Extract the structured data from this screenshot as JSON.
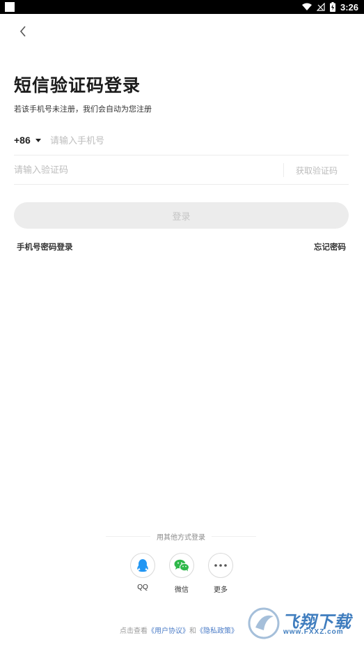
{
  "status_bar": {
    "time": "3:26",
    "icons": [
      "app-notification-icon",
      "wifi-icon",
      "no-signal-icon",
      "battery-charging-icon"
    ]
  },
  "header": {
    "back_icon": "chevron-left-icon",
    "title": "短信验证码登录",
    "subtitle": "若该手机号未注册，我们会自动为您注册"
  },
  "form": {
    "country_code": "+86",
    "phone_placeholder": "请输入手机号",
    "phone_value": "",
    "code_placeholder": "请输入验证码",
    "code_value": "",
    "get_code_label": "获取验证码",
    "login_label": "登录"
  },
  "links": {
    "password_login": "手机号密码登录",
    "forgot_password": "忘记密码"
  },
  "other_login": {
    "title": "用其他方式登录",
    "options": [
      {
        "label": "QQ",
        "icon": "qq-icon",
        "color": "#2196f3"
      },
      {
        "label": "微信",
        "icon": "wechat-icon",
        "color": "#2fb84a"
      },
      {
        "label": "更多",
        "icon": "more-dots-icon",
        "color": "#555555"
      }
    ]
  },
  "agreement": {
    "prefix": "点击查看",
    "user_agreement": "《用户协议》",
    "and": "和",
    "privacy_policy": "《隐私政策》"
  },
  "watermark": {
    "text": "飞翔下载",
    "sub": "www.FXXZ.com"
  },
  "colors": {
    "accent_link": "#4b7cc7",
    "button_disabled_bg": "#ececec",
    "button_disabled_text": "#c5c5c5"
  }
}
